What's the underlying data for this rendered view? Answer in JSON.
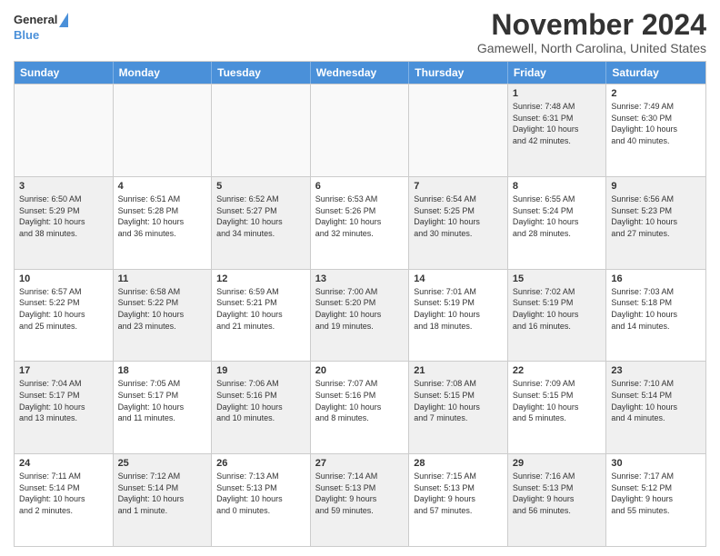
{
  "logo": {
    "line1": "General",
    "line2": "Blue"
  },
  "header": {
    "month": "November 2024",
    "location": "Gamewell, North Carolina, United States"
  },
  "days": [
    "Sunday",
    "Monday",
    "Tuesday",
    "Wednesday",
    "Thursday",
    "Friday",
    "Saturday"
  ],
  "rows": [
    [
      {
        "day": "",
        "info": "",
        "empty": true
      },
      {
        "day": "",
        "info": "",
        "empty": true
      },
      {
        "day": "",
        "info": "",
        "empty": true
      },
      {
        "day": "",
        "info": "",
        "empty": true
      },
      {
        "day": "",
        "info": "",
        "empty": true
      },
      {
        "day": "1",
        "info": "Sunrise: 7:48 AM\nSunset: 6:31 PM\nDaylight: 10 hours\nand 42 minutes.",
        "shaded": true
      },
      {
        "day": "2",
        "info": "Sunrise: 7:49 AM\nSunset: 6:30 PM\nDaylight: 10 hours\nand 40 minutes.",
        "shaded": false
      }
    ],
    [
      {
        "day": "3",
        "info": "Sunrise: 6:50 AM\nSunset: 5:29 PM\nDaylight: 10 hours\nand 38 minutes.",
        "shaded": true
      },
      {
        "day": "4",
        "info": "Sunrise: 6:51 AM\nSunset: 5:28 PM\nDaylight: 10 hours\nand 36 minutes.",
        "shaded": false
      },
      {
        "day": "5",
        "info": "Sunrise: 6:52 AM\nSunset: 5:27 PM\nDaylight: 10 hours\nand 34 minutes.",
        "shaded": true
      },
      {
        "day": "6",
        "info": "Sunrise: 6:53 AM\nSunset: 5:26 PM\nDaylight: 10 hours\nand 32 minutes.",
        "shaded": false
      },
      {
        "day": "7",
        "info": "Sunrise: 6:54 AM\nSunset: 5:25 PM\nDaylight: 10 hours\nand 30 minutes.",
        "shaded": true
      },
      {
        "day": "8",
        "info": "Sunrise: 6:55 AM\nSunset: 5:24 PM\nDaylight: 10 hours\nand 28 minutes.",
        "shaded": false
      },
      {
        "day": "9",
        "info": "Sunrise: 6:56 AM\nSunset: 5:23 PM\nDaylight: 10 hours\nand 27 minutes.",
        "shaded": true
      }
    ],
    [
      {
        "day": "10",
        "info": "Sunrise: 6:57 AM\nSunset: 5:22 PM\nDaylight: 10 hours\nand 25 minutes.",
        "shaded": false
      },
      {
        "day": "11",
        "info": "Sunrise: 6:58 AM\nSunset: 5:22 PM\nDaylight: 10 hours\nand 23 minutes.",
        "shaded": true
      },
      {
        "day": "12",
        "info": "Sunrise: 6:59 AM\nSunset: 5:21 PM\nDaylight: 10 hours\nand 21 minutes.",
        "shaded": false
      },
      {
        "day": "13",
        "info": "Sunrise: 7:00 AM\nSunset: 5:20 PM\nDaylight: 10 hours\nand 19 minutes.",
        "shaded": true
      },
      {
        "day": "14",
        "info": "Sunrise: 7:01 AM\nSunset: 5:19 PM\nDaylight: 10 hours\nand 18 minutes.",
        "shaded": false
      },
      {
        "day": "15",
        "info": "Sunrise: 7:02 AM\nSunset: 5:19 PM\nDaylight: 10 hours\nand 16 minutes.",
        "shaded": true
      },
      {
        "day": "16",
        "info": "Sunrise: 7:03 AM\nSunset: 5:18 PM\nDaylight: 10 hours\nand 14 minutes.",
        "shaded": false
      }
    ],
    [
      {
        "day": "17",
        "info": "Sunrise: 7:04 AM\nSunset: 5:17 PM\nDaylight: 10 hours\nand 13 minutes.",
        "shaded": true
      },
      {
        "day": "18",
        "info": "Sunrise: 7:05 AM\nSunset: 5:17 PM\nDaylight: 10 hours\nand 11 minutes.",
        "shaded": false
      },
      {
        "day": "19",
        "info": "Sunrise: 7:06 AM\nSunset: 5:16 PM\nDaylight: 10 hours\nand 10 minutes.",
        "shaded": true
      },
      {
        "day": "20",
        "info": "Sunrise: 7:07 AM\nSunset: 5:16 PM\nDaylight: 10 hours\nand 8 minutes.",
        "shaded": false
      },
      {
        "day": "21",
        "info": "Sunrise: 7:08 AM\nSunset: 5:15 PM\nDaylight: 10 hours\nand 7 minutes.",
        "shaded": true
      },
      {
        "day": "22",
        "info": "Sunrise: 7:09 AM\nSunset: 5:15 PM\nDaylight: 10 hours\nand 5 minutes.",
        "shaded": false
      },
      {
        "day": "23",
        "info": "Sunrise: 7:10 AM\nSunset: 5:14 PM\nDaylight: 10 hours\nand 4 minutes.",
        "shaded": true
      }
    ],
    [
      {
        "day": "24",
        "info": "Sunrise: 7:11 AM\nSunset: 5:14 PM\nDaylight: 10 hours\nand 2 minutes.",
        "shaded": false
      },
      {
        "day": "25",
        "info": "Sunrise: 7:12 AM\nSunset: 5:14 PM\nDaylight: 10 hours\nand 1 minute.",
        "shaded": true
      },
      {
        "day": "26",
        "info": "Sunrise: 7:13 AM\nSunset: 5:13 PM\nDaylight: 10 hours\nand 0 minutes.",
        "shaded": false
      },
      {
        "day": "27",
        "info": "Sunrise: 7:14 AM\nSunset: 5:13 PM\nDaylight: 9 hours\nand 59 minutes.",
        "shaded": true
      },
      {
        "day": "28",
        "info": "Sunrise: 7:15 AM\nSunset: 5:13 PM\nDaylight: 9 hours\nand 57 minutes.",
        "shaded": false
      },
      {
        "day": "29",
        "info": "Sunrise: 7:16 AM\nSunset: 5:13 PM\nDaylight: 9 hours\nand 56 minutes.",
        "shaded": true
      },
      {
        "day": "30",
        "info": "Sunrise: 7:17 AM\nSunset: 5:12 PM\nDaylight: 9 hours\nand 55 minutes.",
        "shaded": false
      }
    ]
  ]
}
